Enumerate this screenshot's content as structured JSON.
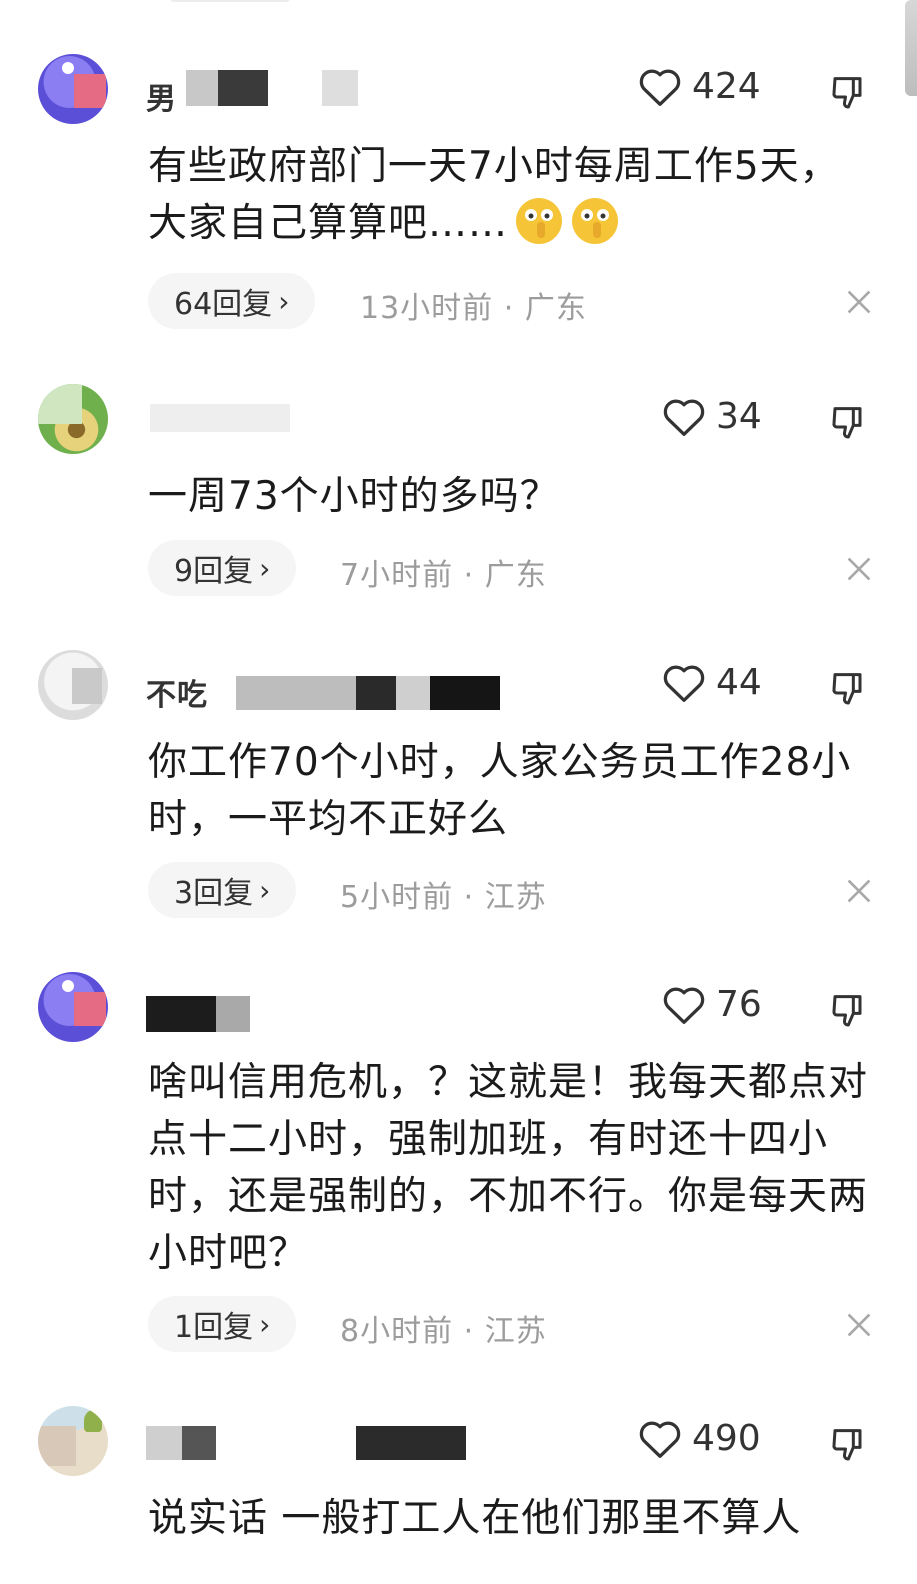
{
  "comments": [
    {
      "name": "男",
      "likes": "424",
      "text": "有些政府部门一天7小时每周工作5天，大家自己算算吧……",
      "replies": "64回复",
      "time": "13小时前",
      "sep": "·",
      "location": "广东"
    },
    {
      "name": "",
      "likes": "34",
      "text": "一周73个小时的多吗？",
      "replies": "9回复",
      "time": "7小时前",
      "sep": "·",
      "location": "广东"
    },
    {
      "name": "不吃",
      "likes": "44",
      "text": "你工作70个小时，人家公务员工作28小时，一平均不正好么",
      "replies": "3回复",
      "time": "5小时前",
      "sep": "·",
      "location": "江苏"
    },
    {
      "name": "",
      "likes": "76",
      "text": "啥叫信用危机，？这就是！我每天都点对点十二小时，强制加班，有时还十四小时，还是强制的，不加不行。你是每天两小时吧？",
      "replies": "1回复",
      "time": "8小时前",
      "sep": "·",
      "location": "江苏"
    },
    {
      "name": "",
      "likes": "490",
      "text": "说实话 一般打工人在他们那里不算人"
    }
  ],
  "icons": {
    "like": "heart-outline-icon",
    "dislike": "thumbs-down-icon",
    "close": "close-icon",
    "reply_chevron": "chevron-right-icon"
  },
  "colors": {
    "meta_text": "#9c9c9c",
    "reply_pill": "#f5f5f5"
  }
}
